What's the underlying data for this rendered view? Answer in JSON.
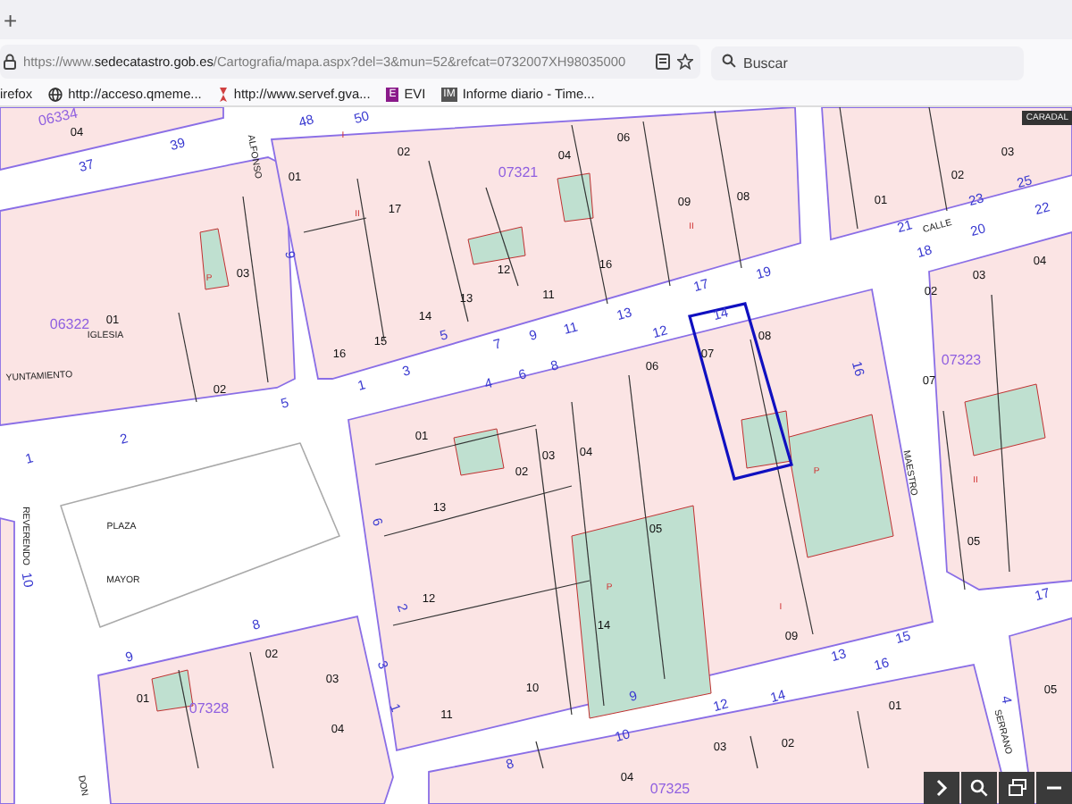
{
  "browser": {
    "new_tab": "+",
    "url": "https://www.**sedecatastro.gob.es**/Cartografia/mapa.aspx?del=3&mun=52&refcat=0732007XH98035000",
    "search_placeholder": "Buscar",
    "bookmarks": [
      {
        "label": "irefox",
        "kind": "plain"
      },
      {
        "label": "http://acceso.qmeme...",
        "kind": "globe"
      },
      {
        "label": "http://www.servef.gva...",
        "kind": "servef"
      },
      {
        "label": "EVI",
        "kind": "letter",
        "icon_text": "E",
        "color": "#8a1a8a"
      },
      {
        "label": "Informe diario - Time...",
        "kind": "letter",
        "icon_text": "IM",
        "color": "#555555"
      }
    ]
  },
  "map": {
    "overlay_label": "CARADAL",
    "labels": [
      {
        "text": "06334",
        "kind": "block"
      },
      {
        "text": "04",
        "kind": "parcel"
      },
      {
        "text": "37",
        "kind": "number"
      },
      {
        "text": "39",
        "kind": "number"
      },
      {
        "text": "48",
        "kind": "number"
      },
      {
        "text": "50",
        "kind": "number"
      },
      {
        "text": "ALFONSO",
        "kind": "street"
      },
      {
        "text": "9",
        "kind": "number"
      },
      {
        "text": "01",
        "kind": "parcel"
      },
      {
        "text": "02",
        "kind": "parcel"
      },
      {
        "text": "17",
        "kind": "parcel"
      },
      {
        "text": "13",
        "kind": "parcel"
      },
      {
        "text": "12",
        "kind": "parcel"
      },
      {
        "text": "14",
        "kind": "parcel"
      },
      {
        "text": "15",
        "kind": "parcel"
      },
      {
        "text": "16",
        "kind": "parcel"
      },
      {
        "text": "07321",
        "kind": "block"
      },
      {
        "text": "06322",
        "kind": "block"
      },
      {
        "text": "01",
        "kind": "parcel"
      },
      {
        "text": "IGLESIA",
        "kind": "street"
      },
      {
        "text": "03",
        "kind": "parcel"
      },
      {
        "text": "02",
        "kind": "parcel"
      },
      {
        "text": "YUNTAMIENTO",
        "kind": "street"
      },
      {
        "text": "04",
        "kind": "parcel"
      },
      {
        "text": "06",
        "kind": "parcel"
      },
      {
        "text": "09",
        "kind": "parcel"
      },
      {
        "text": "08",
        "kind": "parcel"
      },
      {
        "text": "16",
        "kind": "parcel"
      },
      {
        "text": "11",
        "kind": "parcel"
      },
      {
        "text": "01",
        "kind": "parcel"
      },
      {
        "text": "02",
        "kind": "parcel"
      },
      {
        "text": "03",
        "kind": "parcel"
      },
      {
        "text": "CALLE",
        "kind": "street"
      },
      {
        "text": "21",
        "kind": "number"
      },
      {
        "text": "23",
        "kind": "number"
      },
      {
        "text": "25",
        "kind": "number"
      },
      {
        "text": "22",
        "kind": "number"
      },
      {
        "text": "20",
        "kind": "number"
      },
      {
        "text": "18",
        "kind": "number"
      },
      {
        "text": "1",
        "kind": "number"
      },
      {
        "text": "3",
        "kind": "number"
      },
      {
        "text": "5",
        "kind": "number"
      },
      {
        "text": "7",
        "kind": "number"
      },
      {
        "text": "9",
        "kind": "number"
      },
      {
        "text": "11",
        "kind": "number"
      },
      {
        "text": "13",
        "kind": "number"
      },
      {
        "text": "17",
        "kind": "number"
      },
      {
        "text": "19",
        "kind": "number"
      },
      {
        "text": "4",
        "kind": "number"
      },
      {
        "text": "6",
        "kind": "number"
      },
      {
        "text": "8",
        "kind": "number"
      },
      {
        "text": "12",
        "kind": "number"
      },
      {
        "text": "14",
        "kind": "number"
      },
      {
        "text": "16",
        "kind": "number"
      },
      {
        "text": "07",
        "kind": "parcel"
      },
      {
        "text": "08",
        "kind": "parcel"
      },
      {
        "text": "06",
        "kind": "parcel"
      },
      {
        "text": "02",
        "kind": "parcel"
      },
      {
        "text": "03",
        "kind": "parcel"
      },
      {
        "text": "04",
        "kind": "parcel"
      },
      {
        "text": "07323",
        "kind": "block"
      },
      {
        "text": "07",
        "kind": "parcel"
      },
      {
        "text": "5",
        "kind": "number"
      },
      {
        "text": "2",
        "kind": "number"
      },
      {
        "text": "1",
        "kind": "number"
      },
      {
        "text": "01",
        "kind": "parcel"
      },
      {
        "text": "13",
        "kind": "parcel"
      },
      {
        "text": "12",
        "kind": "parcel"
      },
      {
        "text": "02",
        "kind": "parcel"
      },
      {
        "text": "03",
        "kind": "parcel"
      },
      {
        "text": "04",
        "kind": "parcel"
      },
      {
        "text": "05",
        "kind": "parcel"
      },
      {
        "text": "14",
        "kind": "parcel"
      },
      {
        "text": "09",
        "kind": "parcel"
      },
      {
        "text": "10",
        "kind": "parcel"
      },
      {
        "text": "11",
        "kind": "parcel"
      },
      {
        "text": "PLAZA",
        "kind": "street"
      },
      {
        "text": "MAYOR",
        "kind": "street"
      },
      {
        "text": "REVERENDO",
        "kind": "street"
      },
      {
        "text": "10",
        "kind": "number"
      },
      {
        "text": "6",
        "kind": "number"
      },
      {
        "text": "2",
        "kind": "number"
      },
      {
        "text": "3",
        "kind": "number"
      },
      {
        "text": "1",
        "kind": "number"
      },
      {
        "text": "9",
        "kind": "number"
      },
      {
        "text": "8",
        "kind": "number"
      },
      {
        "text": "07328",
        "kind": "block"
      },
      {
        "text": "01",
        "kind": "parcel"
      },
      {
        "text": "02",
        "kind": "parcel"
      },
      {
        "text": "03",
        "kind": "parcel"
      },
      {
        "text": "04",
        "kind": "parcel"
      },
      {
        "text": "MAESTRO",
        "kind": "street"
      },
      {
        "text": "05",
        "kind": "parcel"
      },
      {
        "text": "17",
        "kind": "number"
      },
      {
        "text": "13",
        "kind": "number"
      },
      {
        "text": "15",
        "kind": "number"
      },
      {
        "text": "9",
        "kind": "number"
      },
      {
        "text": "10",
        "kind": "number"
      },
      {
        "text": "12",
        "kind": "number"
      },
      {
        "text": "14",
        "kind": "number"
      },
      {
        "text": "16",
        "kind": "number"
      },
      {
        "text": "8",
        "kind": "number"
      },
      {
        "text": "01",
        "kind": "parcel"
      },
      {
        "text": "02",
        "kind": "parcel"
      },
      {
        "text": "03",
        "kind": "parcel"
      },
      {
        "text": "04",
        "kind": "parcel"
      },
      {
        "text": "07325",
        "kind": "block"
      },
      {
        "text": "4",
        "kind": "number"
      },
      {
        "text": "SERRANO",
        "kind": "street"
      },
      {
        "text": "05",
        "kind": "parcel"
      },
      {
        "text": "DON",
        "kind": "street"
      },
      {
        "text": "P",
        "kind": "use"
      },
      {
        "text": "II",
        "kind": "use"
      },
      {
        "text": "I",
        "kind": "use"
      },
      {
        "text": "II",
        "kind": "use"
      },
      {
        "text": "P",
        "kind": "use"
      },
      {
        "text": "I",
        "kind": "use"
      },
      {
        "text": "P",
        "kind": "use"
      },
      {
        "text": "II",
        "kind": "use"
      }
    ]
  }
}
